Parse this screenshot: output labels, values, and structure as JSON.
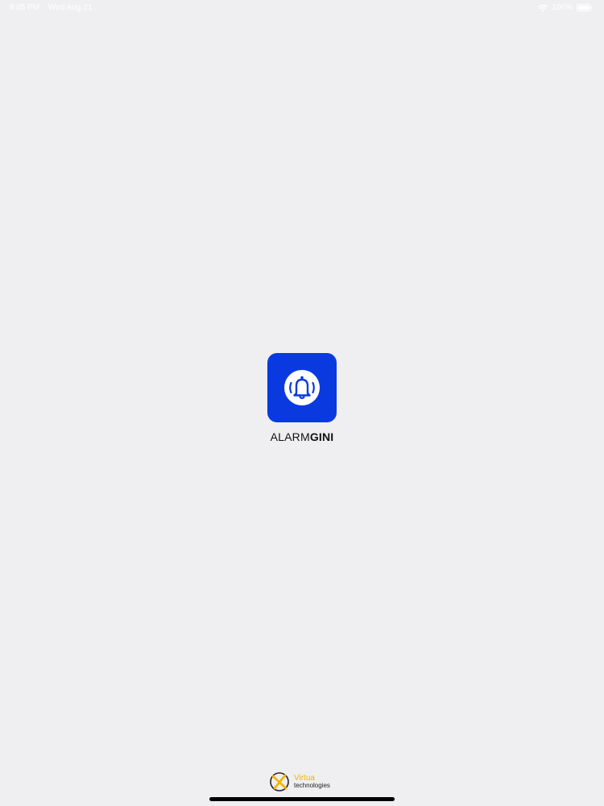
{
  "status_bar": {
    "time": "9:05 PM",
    "date": "Wed Aug 21",
    "battery": "100%"
  },
  "app": {
    "wordmark_light": "ALARM",
    "wordmark_bold": "GINI",
    "icon": "bell-icon",
    "accent_color": "#0a3adf"
  },
  "vendor": {
    "name": "Virtua",
    "subtitle": "technologies",
    "icon": "virtua-logo-icon"
  }
}
